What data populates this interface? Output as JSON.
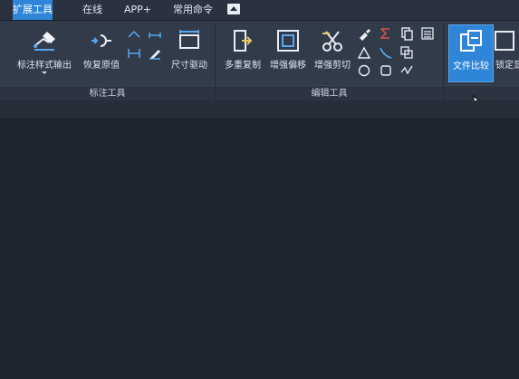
{
  "tabs": [
    {
      "label": "扩展工具",
      "active": true
    },
    {
      "label": "在线",
      "active": false
    },
    {
      "label": "APP+",
      "active": false
    },
    {
      "label": "常用命令",
      "active": false
    }
  ],
  "panels": {
    "annotate": {
      "title": "标注工具",
      "buttons": [
        {
          "label": "标注样式输出",
          "icon": "dimension-style-output-icon"
        },
        {
          "label": "恢复原值",
          "icon": "restore-value-icon"
        },
        {
          "label": "尺寸驱动",
          "icon": "dimension-drive-icon"
        }
      ],
      "small_icons": [
        "dim-linear-icon",
        "dim-aligned-icon",
        "dim-baseline-icon",
        "dim-edit-icon"
      ]
    },
    "edit": {
      "title": "编辑工具",
      "buttons": [
        {
          "label": "多重复制",
          "icon": "multi-copy-icon"
        },
        {
          "label": "增强偏移",
          "icon": "enhanced-offset-icon"
        },
        {
          "label": "增强剪切",
          "icon": "enhanced-trim-icon"
        }
      ],
      "small_icons": [
        "brush-icon",
        "sigma-icon",
        "copy-doc-icon",
        "list-icon",
        "triangle-icon",
        "curve-icon",
        "overlap-icon",
        "circle-icon",
        "square-icon",
        "wave-icon"
      ]
    },
    "file": {
      "buttons": [
        {
          "label": "文件比较",
          "icon": "file-compare-icon",
          "highlighted": true
        },
        {
          "label": "锁定显",
          "icon": "lock-display-icon"
        }
      ]
    }
  },
  "colors": {
    "accent": "#2f86d8",
    "ribbon": "#323b49",
    "canvas": "#1e2430"
  }
}
